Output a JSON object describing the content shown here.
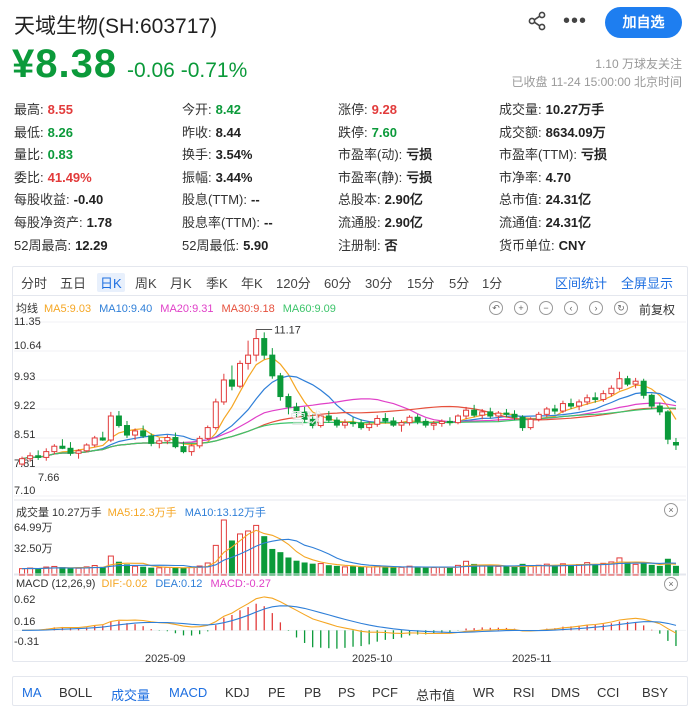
{
  "header": {
    "title": "天域生物(SH:603717)",
    "follow_button": "加自选",
    "price": "¥8.38",
    "change": "-0.06 -0.71%",
    "followers": "1.10 万球友关注",
    "status": "已收盘 11-24 15:00:00 北京时间"
  },
  "quote": [
    {
      "label": "最高:",
      "value": "8.55",
      "color": "red"
    },
    {
      "label": "今开:",
      "value": "8.42",
      "color": "green"
    },
    {
      "label": "涨停:",
      "value": "9.28",
      "color": "red"
    },
    {
      "label": "成交量:",
      "value": "10.27万手",
      "color": ""
    },
    {
      "label": "最低:",
      "value": "8.26",
      "color": "green"
    },
    {
      "label": "昨收:",
      "value": "8.44",
      "color": ""
    },
    {
      "label": "跌停:",
      "value": "7.60",
      "color": "green"
    },
    {
      "label": "成交额:",
      "value": "8634.09万",
      "color": ""
    },
    {
      "label": "量比:",
      "value": "0.83",
      "color": "green"
    },
    {
      "label": "换手:",
      "value": "3.54%",
      "color": ""
    },
    {
      "label": "市盈率(动):",
      "value": "亏损",
      "color": ""
    },
    {
      "label": "市盈率(TTM):",
      "value": "亏损",
      "color": ""
    },
    {
      "label": "委比:",
      "value": "41.49%",
      "color": "red"
    },
    {
      "label": "振幅:",
      "value": "3.44%",
      "color": ""
    },
    {
      "label": "市盈率(静):",
      "value": "亏损",
      "color": ""
    },
    {
      "label": "市净率:",
      "value": "4.70",
      "color": ""
    },
    {
      "label": "每股收益:",
      "value": "-0.40",
      "color": ""
    },
    {
      "label": "股息(TTM):",
      "value": "--",
      "color": ""
    },
    {
      "label": "总股本:",
      "value": "2.90亿",
      "color": ""
    },
    {
      "label": "总市值:",
      "value": "24.31亿",
      "color": ""
    },
    {
      "label": "每股净资产:",
      "value": "1.78",
      "color": ""
    },
    {
      "label": "股息率(TTM):",
      "value": "--",
      "color": ""
    },
    {
      "label": "流通股:",
      "value": "2.90亿",
      "color": ""
    },
    {
      "label": "流通值:",
      "value": "24.31亿",
      "color": ""
    },
    {
      "label": "52周最高:",
      "value": "12.29",
      "color": ""
    },
    {
      "label": "52周最低:",
      "value": "5.90",
      "color": ""
    },
    {
      "label": "注册制:",
      "value": "否",
      "color": ""
    },
    {
      "label": "货币单位:",
      "value": "CNY",
      "color": ""
    }
  ],
  "period_tabs": [
    "分时",
    "五日",
    "日K",
    "周K",
    "月K",
    "季K",
    "年K",
    "120分",
    "60分",
    "30分",
    "15分",
    "5分",
    "1分"
  ],
  "active_tab": "日K",
  "range_stats": "区间统计",
  "fullscreen": "全屏显示",
  "ma_legend": {
    "prefix": "均线",
    "items": [
      {
        "text": "MA5:9.03",
        "color": "#f5a623"
      },
      {
        "text": "MA10:9.40",
        "color": "#2f7fd8"
      },
      {
        "text": "MA20:9.31",
        "color": "#e040c8"
      },
      {
        "text": "MA30:9.18",
        "color": "#e6503c"
      },
      {
        "text": "MA60:9.09",
        "color": "#3cc46a"
      }
    ]
  },
  "fuquan": "前复权",
  "price_axis": [
    "11.35",
    "10.64",
    "9.93",
    "9.22",
    "8.51",
    "7.81",
    "7.10"
  ],
  "max_marker": "11.17",
  "min_marker": "7.66",
  "volume_legend": {
    "prefix": "成交量 10.27万手",
    "items": [
      {
        "text": "MA5:12.3万手",
        "color": "#f5a623"
      },
      {
        "text": "MA10:13.12万手",
        "color": "#2f7fd8"
      }
    ]
  },
  "volume_axis": [
    "64.99万",
    "32.50万"
  ],
  "macd_legend": {
    "prefix": "MACD (12,26,9)",
    "items": [
      {
        "text": "DIF:-0.02",
        "color": "#f5a623"
      },
      {
        "text": "DEA:0.12",
        "color": "#2f7fd8"
      },
      {
        "text": "MACD:-0.27",
        "color": "#e040c8"
      }
    ]
  },
  "macd_axis": [
    "0.62",
    "0.16",
    "-0.31"
  ],
  "dates": [
    "2025-09",
    "2025-10",
    "2025-11"
  ],
  "indicator_tabs": [
    {
      "label": "MA",
      "active": true
    },
    {
      "label": "BOLL",
      "active": false
    },
    {
      "label": "成交量",
      "active": true
    },
    {
      "label": "MACD",
      "active": true
    },
    {
      "label": "KDJ",
      "active": false
    },
    {
      "label": "PE",
      "active": false
    },
    {
      "label": "PB",
      "active": false
    },
    {
      "label": "PS",
      "active": false
    },
    {
      "label": "PCF",
      "active": false
    },
    {
      "label": "总市值",
      "active": false
    },
    {
      "label": "WR",
      "active": false
    },
    {
      "label": "RSI",
      "active": false
    },
    {
      "label": "DMS",
      "active": false
    },
    {
      "label": "CCI",
      "active": false
    },
    {
      "label": "BSY",
      "active": false
    }
  ],
  "chart_data": {
    "type": "candlestick",
    "ohlc": [
      [
        7.92,
        8.1,
        7.88,
        8.05
      ],
      [
        8.05,
        8.2,
        7.98,
        8.12
      ],
      [
        8.12,
        8.25,
        8.02,
        8.08
      ],
      [
        8.08,
        8.3,
        8.0,
        8.22
      ],
      [
        8.22,
        8.4,
        8.15,
        8.35
      ],
      [
        8.35,
        8.52,
        8.28,
        8.3
      ],
      [
        8.3,
        8.45,
        8.12,
        8.18
      ],
      [
        8.18,
        8.28,
        8.05,
        8.24
      ],
      [
        8.24,
        8.42,
        8.2,
        8.38
      ],
      [
        8.38,
        8.6,
        8.33,
        8.55
      ],
      [
        8.55,
        8.7,
        8.48,
        8.5
      ],
      [
        8.5,
        9.18,
        8.45,
        9.08
      ],
      [
        9.08,
        9.2,
        8.8,
        8.85
      ],
      [
        8.85,
        8.96,
        8.55,
        8.62
      ],
      [
        8.62,
        8.78,
        8.5,
        8.72
      ],
      [
        8.72,
        8.85,
        8.55,
        8.6
      ],
      [
        8.6,
        8.66,
        8.35,
        8.42
      ],
      [
        8.42,
        8.55,
        8.3,
        8.48
      ],
      [
        8.48,
        8.62,
        8.4,
        8.56
      ],
      [
        8.56,
        8.68,
        8.3,
        8.34
      ],
      [
        8.34,
        8.46,
        8.18,
        8.22
      ],
      [
        8.22,
        8.4,
        8.12,
        8.36
      ],
      [
        8.36,
        8.6,
        8.3,
        8.54
      ],
      [
        8.54,
        8.85,
        8.5,
        8.8
      ],
      [
        8.8,
        9.5,
        8.75,
        9.42
      ],
      [
        9.42,
        10.1,
        9.35,
        9.95
      ],
      [
        9.95,
        10.3,
        9.7,
        9.8
      ],
      [
        9.8,
        10.42,
        9.75,
        10.35
      ],
      [
        10.35,
        10.9,
        10.2,
        10.55
      ],
      [
        10.55,
        11.17,
        10.4,
        10.95
      ],
      [
        10.95,
        11.1,
        10.45,
        10.55
      ],
      [
        10.55,
        10.72,
        9.98,
        10.05
      ],
      [
        10.05,
        10.12,
        9.45,
        9.55
      ],
      [
        9.55,
        9.62,
        9.12,
        9.3
      ],
      [
        9.3,
        9.4,
        9.05,
        9.18
      ],
      [
        9.18,
        9.3,
        8.92,
        9.0
      ],
      [
        9.0,
        9.12,
        8.78,
        8.85
      ],
      [
        8.85,
        9.15,
        8.8,
        9.08
      ],
      [
        9.08,
        9.2,
        8.92,
        8.98
      ],
      [
        8.98,
        9.05,
        8.8,
        8.86
      ],
      [
        8.86,
        9.0,
        8.78,
        8.92
      ],
      [
        8.92,
        9.05,
        8.82,
        8.9
      ],
      [
        8.9,
        9.0,
        8.75,
        8.8
      ],
      [
        8.8,
        8.95,
        8.72,
        8.88
      ],
      [
        8.88,
        9.1,
        8.82,
        9.02
      ],
      [
        9.02,
        9.15,
        8.9,
        8.96
      ],
      [
        8.96,
        9.05,
        8.82,
        8.86
      ],
      [
        8.86,
        8.98,
        8.7,
        8.92
      ],
      [
        8.92,
        9.1,
        8.85,
        9.05
      ],
      [
        9.05,
        9.12,
        8.88,
        8.95
      ],
      [
        8.95,
        9.02,
        8.8,
        8.86
      ],
      [
        8.86,
        8.96,
        8.74,
        8.9
      ],
      [
        8.9,
        9.0,
        8.82,
        8.95
      ],
      [
        8.95,
        9.05,
        8.85,
        8.92
      ],
      [
        8.92,
        9.12,
        8.88,
        9.08
      ],
      [
        9.08,
        9.3,
        9.0,
        9.22
      ],
      [
        9.22,
        9.35,
        9.05,
        9.1
      ],
      [
        9.1,
        9.25,
        9.0,
        9.18
      ],
      [
        9.18,
        9.28,
        9.02,
        9.08
      ],
      [
        9.08,
        9.2,
        8.95,
        9.15
      ],
      [
        9.15,
        9.25,
        9.05,
        9.12
      ],
      [
        9.12,
        9.22,
        8.98,
        9.05
      ],
      [
        9.05,
        9.1,
        8.72,
        8.8
      ],
      [
        8.8,
        9.05,
        8.75,
        9.0
      ],
      [
        9.0,
        9.18,
        8.95,
        9.12
      ],
      [
        9.12,
        9.3,
        9.05,
        9.25
      ],
      [
        9.25,
        9.35,
        9.12,
        9.2
      ],
      [
        9.2,
        9.45,
        9.15,
        9.38
      ],
      [
        9.38,
        9.5,
        9.25,
        9.32
      ],
      [
        9.32,
        9.48,
        9.22,
        9.42
      ],
      [
        9.42,
        9.6,
        9.35,
        9.52
      ],
      [
        9.52,
        9.65,
        9.4,
        9.48
      ],
      [
        9.48,
        9.7,
        9.42,
        9.62
      ],
      [
        9.62,
        9.82,
        9.55,
        9.75
      ],
      [
        9.75,
        10.15,
        9.7,
        9.98
      ],
      [
        9.98,
        10.05,
        9.8,
        9.85
      ],
      [
        9.85,
        10.0,
        9.75,
        9.92
      ],
      [
        9.92,
        9.98,
        9.5,
        9.58
      ],
      [
        9.58,
        9.62,
        9.25,
        9.32
      ],
      [
        9.32,
        9.4,
        9.1,
        9.18
      ],
      [
        9.18,
        9.22,
        8.4,
        8.52
      ],
      [
        8.44,
        8.55,
        8.26,
        8.38
      ]
    ],
    "volume_wan": [
      7.5,
      8.2,
      6.9,
      9.4,
      10.1,
      8.8,
      7.2,
      8.0,
      9.6,
      11.2,
      9.0,
      22.4,
      15.1,
      12.0,
      10.4,
      9.2,
      8.1,
      8.5,
      9.0,
      8.8,
      8.2,
      9.1,
      10.6,
      14.2,
      35.0,
      64.99,
      40.2,
      48.5,
      52.0,
      58.6,
      45.3,
      30.2,
      26.4,
      20.1,
      16.3,
      14.2,
      12.8,
      13.5,
      11.0,
      10.2,
      9.6,
      9.9,
      8.8,
      9.4,
      10.8,
      9.2,
      8.6,
      9.0,
      10.4,
      9.5,
      8.3,
      8.8,
      9.2,
      9.0,
      11.4,
      16.2,
      12.5,
      10.8,
      9.6,
      10.2,
      9.8,
      9.1,
      12.6,
      10.4,
      11.5,
      12.8,
      10.6,
      13.2,
      11.8,
      12.4,
      14.6,
      12.0,
      13.8,
      15.4,
      20.2,
      14.3,
      12.6,
      13.1,
      11.4,
      10.2,
      18.6,
      10.27
    ],
    "series": [
      {
        "name": "MA5",
        "color": "#f5a623"
      },
      {
        "name": "MA10",
        "color": "#2f7fd8"
      },
      {
        "name": "MA20",
        "color": "#e040c8"
      },
      {
        "name": "MA30",
        "color": "#e6503c"
      },
      {
        "name": "MA60",
        "color": "#3cc46a"
      }
    ],
    "ylim": [
      7.1,
      11.35
    ],
    "volume_ylim": [
      0,
      64.99
    ],
    "macd_ylim": [
      -0.31,
      0.62
    ]
  }
}
